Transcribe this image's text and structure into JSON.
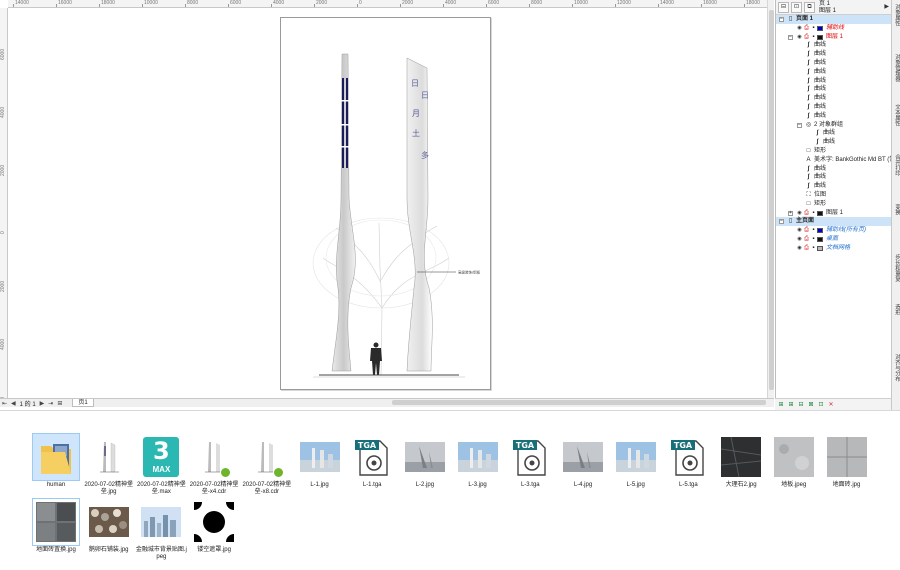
{
  "ruler": {
    "h_ticks": [
      "14000",
      "16000",
      "18000",
      "10000",
      "8000",
      "6000",
      "4000",
      "2000",
      "0",
      "2000",
      "4000",
      "6000",
      "8000",
      "10000",
      "12000",
      "14000",
      "16000",
      "18000"
    ],
    "v_ticks": [
      "6000",
      "4000",
      "2000",
      "0",
      "2000",
      "4000",
      "6000"
    ]
  },
  "drawing": {
    "callout_text": "高级装饰/铝板"
  },
  "bottom_bar": {
    "first": "⇤",
    "prev": "◀",
    "page_indicator": "1 的 1",
    "next": "▶",
    "last": "⇥",
    "add": "⊞",
    "tab_label": "页1"
  },
  "object_manager": {
    "page_title": "页 1",
    "layer_title": "图层 1",
    "rows": [
      {
        "indent": 0,
        "expander": "⊟",
        "icon": "page-icon",
        "glyph": "▯",
        "label": "页面 1",
        "style": "bold",
        "selected": true
      },
      {
        "indent": 1,
        "expander": "",
        "icon": "eye-icon",
        "glyph": "👁",
        "label": "辅助线",
        "style": "red-italic",
        "swatch": "#0000cc"
      },
      {
        "indent": 1,
        "expander": "⊟",
        "icon": "eye-icon",
        "glyph": "👁",
        "label": "图层 1",
        "style": "red",
        "swatch": "#111111"
      },
      {
        "indent": 2,
        "icon": "curve-icon",
        "glyph": "∫",
        "label": "曲线"
      },
      {
        "indent": 2,
        "icon": "curve-icon",
        "glyph": "∫",
        "label": "曲线"
      },
      {
        "indent": 2,
        "icon": "curve-icon",
        "glyph": "∫",
        "label": "曲线"
      },
      {
        "indent": 2,
        "icon": "curve-icon",
        "glyph": "∫",
        "label": "曲线"
      },
      {
        "indent": 2,
        "icon": "curve-icon",
        "glyph": "∫",
        "label": "曲线"
      },
      {
        "indent": 2,
        "icon": "curve-icon",
        "glyph": "∫",
        "label": "曲线"
      },
      {
        "indent": 2,
        "icon": "curve-icon",
        "glyph": "∫",
        "label": "曲线"
      },
      {
        "indent": 2,
        "icon": "curve-icon",
        "glyph": "∫",
        "label": "曲线"
      },
      {
        "indent": 2,
        "icon": "curve-icon",
        "glyph": "∫",
        "label": "曲线"
      },
      {
        "indent": 2,
        "expander": "⊟",
        "icon": "group-icon",
        "glyph": "◎",
        "label": "2 对象群组"
      },
      {
        "indent": 3,
        "icon": "curve-icon",
        "glyph": "∫",
        "label": "曲线"
      },
      {
        "indent": 3,
        "icon": "curve-icon",
        "glyph": "∫",
        "label": "曲线"
      },
      {
        "indent": 2,
        "icon": "rectangle-icon",
        "glyph": "□",
        "label": "矩形"
      },
      {
        "indent": 2,
        "icon": "text-icon",
        "glyph": "A",
        "label": "美术字: BankGothic Md BT (常"
      },
      {
        "indent": 2,
        "icon": "curve-icon",
        "glyph": "∫",
        "label": "曲线"
      },
      {
        "indent": 2,
        "icon": "curve-icon",
        "glyph": "∫",
        "label": "曲线"
      },
      {
        "indent": 2,
        "icon": "curve-icon",
        "glyph": "∫",
        "label": "曲线"
      },
      {
        "indent": 2,
        "icon": "bitmap-icon",
        "glyph": "⛶",
        "label": "位图"
      },
      {
        "indent": 2,
        "icon": "rectangle-icon",
        "glyph": "□",
        "label": "矩形"
      },
      {
        "indent": 1,
        "expander": "⊞",
        "icon": "eye-icon",
        "glyph": "👁",
        "label": "图层 1",
        "style": "normal",
        "swatch": "#111111"
      },
      {
        "indent": 0,
        "expander": "⊟",
        "icon": "page-icon",
        "glyph": "▯",
        "label": "主页面",
        "style": "bold",
        "selected": true
      },
      {
        "indent": 1,
        "icon": "eye-icon",
        "glyph": "👁",
        "label": "辅助线(所有页)",
        "style": "blue",
        "swatch": "#0000cc"
      },
      {
        "indent": 1,
        "icon": "eye-icon",
        "glyph": "👁",
        "label": "桌面",
        "style": "blue",
        "swatch": "#111111"
      },
      {
        "indent": 1,
        "icon": "eye-icon",
        "glyph": "👁",
        "label": "文档网格",
        "style": "blue",
        "swatch": "#bbbbbb"
      }
    ],
    "footer_icons": [
      "⊞",
      "⊞",
      "⊟",
      "⊠",
      "⊡",
      "✕"
    ]
  },
  "dock_tabs": [
    "对象属性",
    "对象管理器",
    "文本属性",
    "合并打印",
    "变换",
    "步长和重复",
    "造形",
    "对齐与分布"
  ],
  "files": [
    {
      "name": "human",
      "type": "folder",
      "selected": true
    },
    {
      "name": "2020-07-02精神堡垒.jpg",
      "type": "jpg-tower"
    },
    {
      "name": "2020-07-02精神堡垒.max",
      "type": "max"
    },
    {
      "name": "2020-07-02精神堡垒-x4.cdr",
      "type": "cdr"
    },
    {
      "name": "2020-07-02精神堡垒-x8.cdr",
      "type": "cdr"
    },
    {
      "name": "L-1.jpg",
      "type": "photo-sky"
    },
    {
      "name": "L-1.tga",
      "type": "tga"
    },
    {
      "name": "L-2.jpg",
      "type": "photo-gray"
    },
    {
      "name": "L-3.jpg",
      "type": "photo-sky"
    },
    {
      "name": "L-3.tga",
      "type": "tga"
    },
    {
      "name": "L-4.jpg",
      "type": "photo-gray"
    },
    {
      "name": "L-5.jpg",
      "type": "photo-sky"
    },
    {
      "name": "L-5.tga",
      "type": "tga"
    },
    {
      "name": "大理石2.jpg",
      "type": "marble-dark"
    },
    {
      "name": "地板.jpeg",
      "type": "marble-light"
    },
    {
      "name": "地面砖.jpg",
      "type": "tile"
    },
    {
      "name": "地面砖置换.jpg",
      "type": "tile-dark",
      "selected2": true
    },
    {
      "name": "鹅卵石铺装.jpg",
      "type": "pebble"
    },
    {
      "name": "金融城市背景贴图.jpeg",
      "type": "city"
    },
    {
      "name": "镂空遮罩.jpg",
      "type": "mask"
    }
  ],
  "tga_badge": "TGA"
}
